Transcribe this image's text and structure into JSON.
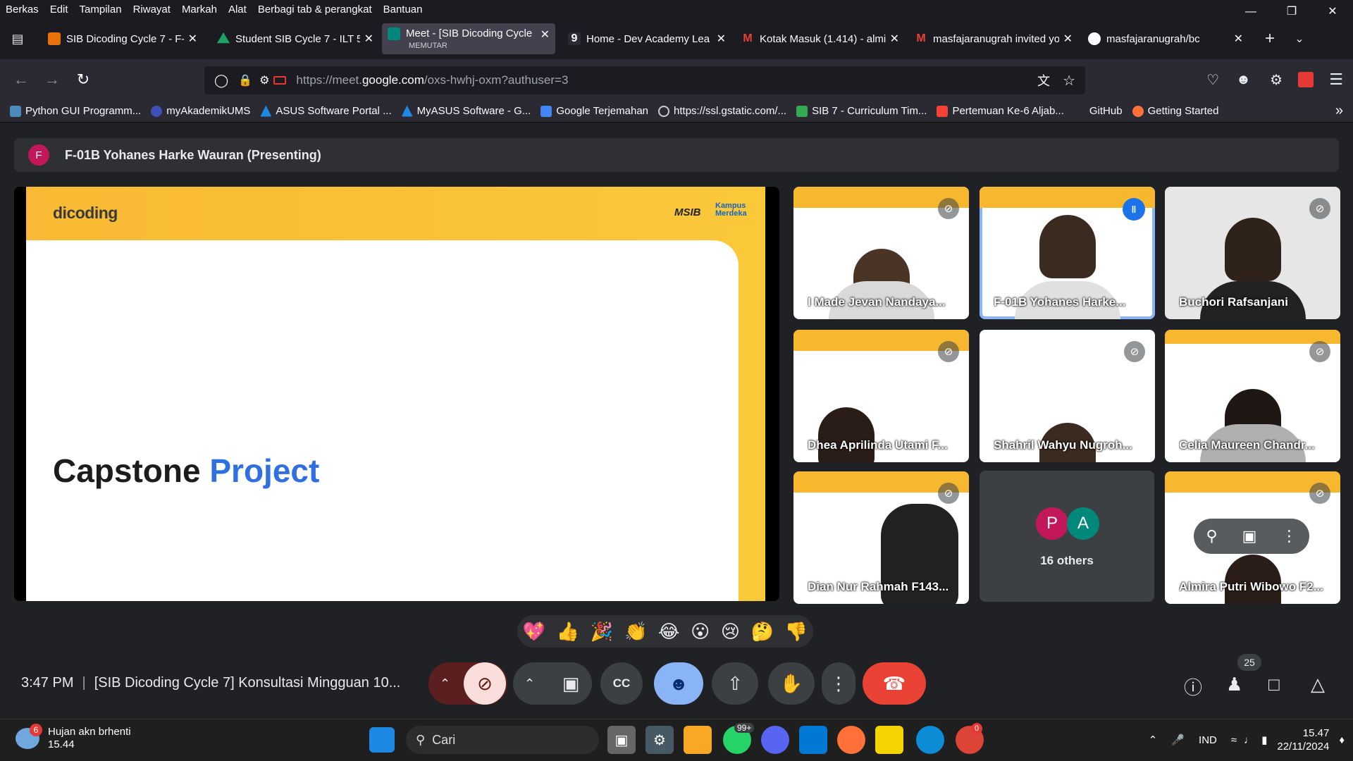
{
  "menubar": {
    "items": [
      "Berkas",
      "Edit",
      "Tampilan",
      "Riwayat",
      "Markah",
      "Alat",
      "Berbagi tab & perangkat",
      "Bantuan"
    ]
  },
  "tabs": [
    {
      "title": "SIB Dicoding Cycle 7 - F-01",
      "color": "#e8710a",
      "icon": "slides-icon"
    },
    {
      "title": "Student SIB Cycle 7 - ILT 5",
      "color": "#1ea362",
      "icon": "drive-icon"
    },
    {
      "title": "Meet - [SIB Dicoding Cycle",
      "sub": "MEMUTAR",
      "color": "#00897b",
      "icon": "meet-icon",
      "active": true
    },
    {
      "title": "Home - Dev Academy Lea",
      "color": "#ffffff",
      "icon": "dicoding-icon"
    },
    {
      "title": "Kotak Masuk (1.414) - almi",
      "color": "#ea4335",
      "icon": "gmail-icon"
    },
    {
      "title": "masfajaranugrah invited yo",
      "color": "#ea4335",
      "icon": "gmail-icon"
    },
    {
      "title": "masfajaranugrah/bc",
      "color": "#ffffff",
      "icon": "github-icon"
    }
  ],
  "url": {
    "prefix": "https://meet.",
    "domain": "google.com",
    "path": "/oxs-hwhj-oxm?authuser=3"
  },
  "bookmarks": [
    {
      "label": "Python GUI Programm...",
      "color": "#4b8bbe"
    },
    {
      "label": "myAkademikUMS",
      "color": "#3f51b5"
    },
    {
      "label": "ASUS Software Portal ...",
      "color": "#1e88e5"
    },
    {
      "label": "MyASUS Software - G...",
      "color": "#1e88e5"
    },
    {
      "label": "Google Terjemahan",
      "color": "#4285f4"
    },
    {
      "label": "https://ssl.gstatic.com/...",
      "color": "#9e9e9e"
    },
    {
      "label": "SIB 7 - Curriculum Tim...",
      "color": "#34a853"
    },
    {
      "label": "Pertemuan Ke-6 Aljab...",
      "color": "#f44336"
    },
    {
      "label": "GitHub",
      "color": "#2b2a33"
    },
    {
      "label": "Getting Started",
      "color": "#ff7139"
    }
  ],
  "presenting": {
    "initial": "F",
    "text": "F-01B Yohanes Harke Wauran (Presenting)"
  },
  "slide": {
    "logo": "dicoding",
    "partner": "MSIB",
    "km": "Kampus Merdeka",
    "title_a": "Capstone ",
    "title_b": "Project"
  },
  "participants": [
    {
      "name": "I Made Jevan Nandaya...",
      "muted": true
    },
    {
      "name": "F-01B Yohanes Harke...",
      "speaking": true
    },
    {
      "name": "Buchori Rafsanjani",
      "muted": true
    },
    {
      "name": "Dhea Aprilinda Utami F...",
      "muted": true
    },
    {
      "name": "Shahril Wahyu Nugroh...",
      "muted": true
    },
    {
      "name": "Celia Maureen Chandr...",
      "muted": true
    },
    {
      "name": "Dian Nur Rahmah F143...",
      "muted": true
    },
    {
      "name": "Almira Putri Wibowo F2...",
      "muted": true
    }
  ],
  "others": {
    "a": "P",
    "b": "A",
    "label": "16 others"
  },
  "reactions": [
    "💖",
    "👍",
    "🎉",
    "👏",
    "😂",
    "😮",
    "😢",
    "🤔",
    "👎"
  ],
  "meeting": {
    "time": "3:47 PM",
    "title": "[SIB Dicoding Cycle 7] Konsultasi Mingguan 10..."
  },
  "people_count": "25",
  "taskbar": {
    "weather_title": "Hujan akn brhenti",
    "weather_time": "15.44",
    "weather_badge": "6",
    "search": "Cari",
    "whatsapp_badge": "99+",
    "chrome_badge": "0",
    "lang": "IND",
    "time": "15.47",
    "date": "22/11/2024"
  }
}
